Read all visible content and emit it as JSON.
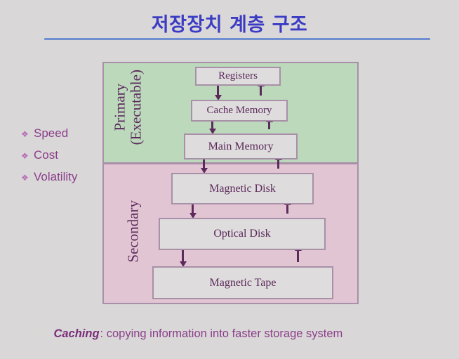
{
  "slide": {
    "title": "저장장치 계층 구조",
    "background_color": "#d9d7d7",
    "rule_color": "#6f8fd0"
  },
  "bullets": {
    "marker": "❖",
    "items": [
      {
        "label": "Speed"
      },
      {
        "label": "Cost"
      },
      {
        "label": "Volatility"
      }
    ]
  },
  "diagram": {
    "bands": [
      {
        "id": "primary",
        "label_line1": "Primary",
        "label_line2": "(Executable)",
        "color": "#bcd9bc"
      },
      {
        "id": "secondary",
        "label_line1": "Secondary",
        "label_line2": "",
        "color": "#e2c5d3"
      }
    ],
    "nodes": [
      {
        "id": "registers",
        "label": "Registers",
        "band": "primary"
      },
      {
        "id": "cache-memory",
        "label": "Cache Memory",
        "band": "primary"
      },
      {
        "id": "main-memory",
        "label": "Main Memory",
        "band": "primary"
      },
      {
        "id": "magnetic-disk",
        "label": "Magnetic Disk",
        "band": "secondary"
      },
      {
        "id": "optical-disk",
        "label": "Optical Disk",
        "band": "secondary"
      },
      {
        "id": "magnetic-tape",
        "label": "Magnetic Tape",
        "band": "secondary"
      }
    ],
    "node_fill": "#dedcdc",
    "node_border": "#a890a8",
    "node_text_color": "#5c2a5c",
    "arrow_color": "#5c2a5c",
    "flows": [
      {
        "from": "registers",
        "to": "cache-memory",
        "direction": "down"
      },
      {
        "from": "cache-memory",
        "to": "registers",
        "direction": "up"
      },
      {
        "from": "cache-memory",
        "to": "main-memory",
        "direction": "down"
      },
      {
        "from": "main-memory",
        "to": "cache-memory",
        "direction": "up"
      },
      {
        "from": "main-memory",
        "to": "magnetic-disk",
        "direction": "down"
      },
      {
        "from": "magnetic-disk",
        "to": "main-memory",
        "direction": "up"
      },
      {
        "from": "magnetic-disk",
        "to": "optical-disk",
        "direction": "down"
      },
      {
        "from": "optical-disk",
        "to": "magnetic-disk",
        "direction": "up"
      },
      {
        "from": "optical-disk",
        "to": "magnetic-tape",
        "direction": "down"
      },
      {
        "from": "magnetic-tape",
        "to": "optical-disk",
        "direction": "up"
      }
    ]
  },
  "caption": {
    "star": "☆",
    "term": "Caching",
    "text": ": copying information into faster storage system"
  }
}
